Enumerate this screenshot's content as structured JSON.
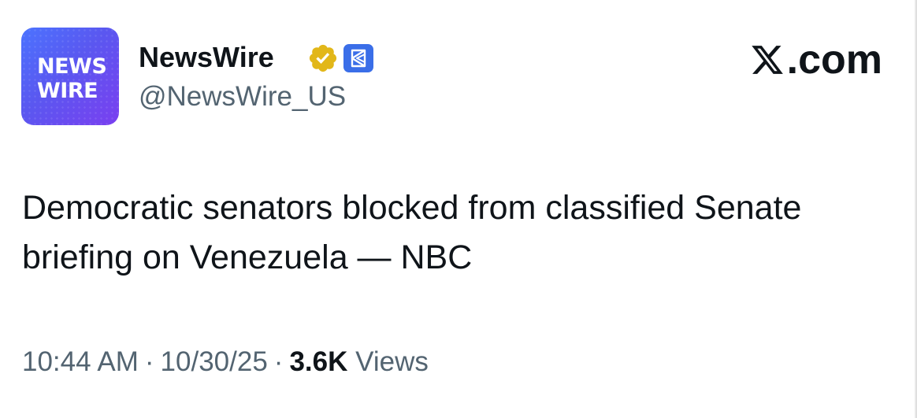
{
  "post": {
    "avatar_text": "NEWS\nWIRE",
    "display_name": "NewsWire",
    "handle": "@NewsWire_US",
    "site_logo_text": ".com",
    "text": "Democratic senators blocked from classified Senate briefing on Venezuela — NBC",
    "time": "10:44 AM",
    "date": "10/30/25",
    "views_count": "3.6K",
    "views_label": "Views",
    "separator": "·"
  },
  "icons": {
    "verified": "verified-badge-icon",
    "affiliate": "affiliate-badge-icon",
    "x_logo": "x-logo-icon"
  },
  "colors": {
    "avatar_gradient_start": "#4b73ff",
    "avatar_gradient_end": "#7a3ff0",
    "verified_gold": "#e2b719",
    "affiliate_blue": "#3a6ee8",
    "text_primary": "#0f1419",
    "text_secondary": "#536471"
  }
}
